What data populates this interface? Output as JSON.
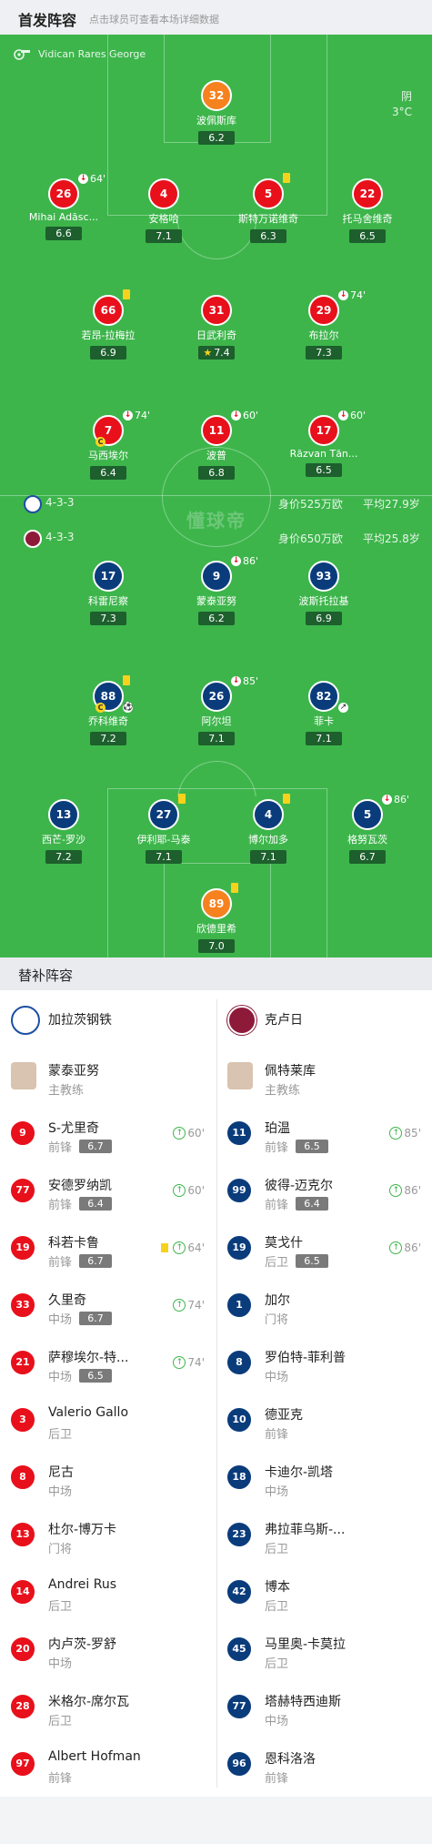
{
  "header": {
    "title": "首发阵容",
    "subtitle": "点击球员可查看本场详细数据"
  },
  "referee": {
    "name": "Vidican Rares George"
  },
  "weather": {
    "condition": "阴",
    "temp": "3°C"
  },
  "home": {
    "name": "加拉茨钢铁",
    "formation": "4-3-3",
    "value": "身价525万欧",
    "age": "平均27.9岁",
    "players": {
      "gk": {
        "number": "32",
        "name": "波佩斯库",
        "rating": "6.2"
      },
      "d1": {
        "number": "26",
        "name": "Mihai Adăsc...",
        "rating": "6.6",
        "sub": "64'"
      },
      "d2": {
        "number": "4",
        "name": "安格哈",
        "rating": "7.1"
      },
      "d3": {
        "number": "5",
        "name": "斯特万诺维奇",
        "rating": "6.3"
      },
      "d4": {
        "number": "22",
        "name": "托马舍维奇",
        "rating": "6.5"
      },
      "m1": {
        "number": "66",
        "name": "若昂-拉梅拉",
        "rating": "6.9"
      },
      "m2": {
        "number": "31",
        "name": "日武利奇",
        "rating": "7.4"
      },
      "m3": {
        "number": "29",
        "name": "布拉尔",
        "rating": "7.3",
        "sub": "74'"
      },
      "f1": {
        "number": "7",
        "name": "马西埃尔",
        "rating": "6.4",
        "sub": "74'",
        "captain": "C"
      },
      "f2": {
        "number": "11",
        "name": "波普",
        "rating": "6.8",
        "sub": "60'"
      },
      "f3": {
        "number": "17",
        "name": "Răzvan Tăn...",
        "rating": "6.5",
        "sub": "60'"
      }
    }
  },
  "away": {
    "name": "克卢日",
    "formation": "4-3-3",
    "value": "身价650万欧",
    "age": "平均25.8岁",
    "players": {
      "f1": {
        "number": "17",
        "name": "科雷尼察",
        "rating": "7.3"
      },
      "f2": {
        "number": "9",
        "name": "蒙泰亚努",
        "rating": "6.2",
        "sub": "86'"
      },
      "f3": {
        "number": "93",
        "name": "波斯托拉基",
        "rating": "6.9"
      },
      "m1": {
        "number": "88",
        "name": "乔科维奇",
        "rating": "7.2",
        "captain": "C"
      },
      "m2": {
        "number": "26",
        "name": "阿尔坦",
        "rating": "7.1",
        "sub": "85'"
      },
      "m3": {
        "number": "82",
        "name": "菲卡",
        "rating": "7.1"
      },
      "d1": {
        "number": "13",
        "name": "西芒-罗沙",
        "rating": "7.2"
      },
      "d2": {
        "number": "27",
        "name": "伊利耶-马泰",
        "rating": "7.1"
      },
      "d3": {
        "number": "4",
        "name": "博尔加多",
        "rating": "7.1"
      },
      "d4": {
        "number": "5",
        "name": "格努瓦茨",
        "rating": "6.7",
        "sub": "86'"
      },
      "gk": {
        "number": "89",
        "name": "欣德里希",
        "rating": "7.0"
      }
    }
  },
  "subs_title": "替补阵容",
  "home_subs": [
    {
      "name": "蒙泰亚努",
      "pos": "主教练"
    },
    {
      "number": "9",
      "name": "S-尤里奇",
      "pos": "前锋",
      "rating": "6.7",
      "time": "60'"
    },
    {
      "number": "77",
      "name": "安德罗纳凯",
      "pos": "前锋",
      "rating": "6.4",
      "time": "60'"
    },
    {
      "number": "19",
      "name": "科若卡鲁",
      "pos": "前锋",
      "rating": "6.7",
      "time": "64'"
    },
    {
      "number": "33",
      "name": "久里奇",
      "pos": "中场",
      "rating": "6.7",
      "time": "74'"
    },
    {
      "number": "21",
      "name": "萨穆埃尔-特...",
      "pos": "中场",
      "rating": "6.5",
      "time": "74'"
    },
    {
      "number": "3",
      "name": "Valerio Gallo",
      "pos": "后卫"
    },
    {
      "number": "8",
      "name": "尼古",
      "pos": "中场"
    },
    {
      "number": "13",
      "name": "杜尔-博万卡",
      "pos": "门将"
    },
    {
      "number": "14",
      "name": "Andrei Rus",
      "pos": "后卫"
    },
    {
      "number": "20",
      "name": "内卢茨-罗舒",
      "pos": "中场"
    },
    {
      "number": "28",
      "name": "米格尔-席尔瓦",
      "pos": "后卫"
    },
    {
      "number": "97",
      "name": "Albert Hofman",
      "pos": "前锋"
    }
  ],
  "away_subs": [
    {
      "name": "佩特莱库",
      "pos": "主教练"
    },
    {
      "number": "11",
      "name": "珀温",
      "pos": "前锋",
      "rating": "6.5",
      "time": "85'"
    },
    {
      "number": "99",
      "name": "彼得-迈克尔",
      "pos": "前锋",
      "rating": "6.4",
      "time": "86'"
    },
    {
      "number": "19",
      "name": "莫戈什",
      "pos": "后卫",
      "rating": "6.5",
      "time": "86'"
    },
    {
      "number": "1",
      "name": "加尔",
      "pos": "门将"
    },
    {
      "number": "8",
      "name": "罗伯特-菲利普",
      "pos": "中场"
    },
    {
      "number": "10",
      "name": "德亚克",
      "pos": "前锋"
    },
    {
      "number": "18",
      "name": "卡迪尔-凯塔",
      "pos": "中场"
    },
    {
      "number": "23",
      "name": "弗拉菲乌斯-...",
      "pos": "后卫"
    },
    {
      "number": "42",
      "name": "博本",
      "pos": "后卫"
    },
    {
      "number": "45",
      "name": "马里奥-卡莫拉",
      "pos": "后卫"
    },
    {
      "number": "77",
      "name": "塔赫特西迪斯",
      "pos": "中场"
    },
    {
      "number": "96",
      "name": "恩科洛洛",
      "pos": "前锋"
    }
  ],
  "watermark": "懂球帝",
  "colors": {
    "pitch": "#3db54b",
    "home": "#e8101b",
    "home_gk": "#f5821f",
    "away": "#0a3c7c"
  }
}
